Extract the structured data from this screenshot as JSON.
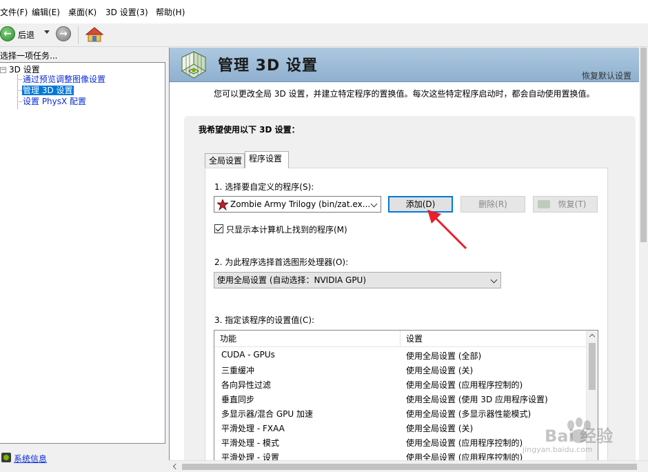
{
  "menu": {
    "items": [
      "文件(F)",
      "编辑(E)",
      "桌面(K)",
      "3D 设置(3)",
      "帮助(H)"
    ]
  },
  "toolbar": {
    "back_label": "后退"
  },
  "left_panel": {
    "header": "选择一项任务...",
    "tree": {
      "root": "3D 设置",
      "children": [
        "通过预览调整图像设置",
        "管理 3D 设置",
        "设置 PhysX 配置"
      ]
    },
    "system_info": "系统信息"
  },
  "banner": {
    "title": "管理 3D 设置",
    "restore_defaults": "恢复默认设置"
  },
  "description": "您可以更改全局 3D 设置，并建立特定程序的置换值。每次这些特定程序启动时，都会自动使用置换值。",
  "settings": {
    "heading": "我希望使用以下 3D 设置：",
    "tabs": [
      "全局设置",
      "程序设置"
    ],
    "step1": {
      "label": "1. 选择要自定义的程序(S):",
      "program_value": "Zombie Army Trilogy (bin/zat.ex...",
      "add_button": "添加(D)",
      "remove_button": "删除(R)",
      "restore_button": "恢复(T)",
      "checkbox_label": "只显示本计算机上找到的程序(M)",
      "checkbox_checked": true
    },
    "step2": {
      "label": "2. 为此程序选择首选图形处理器(O):",
      "gpu_value": "使用全局设置 (自动选择：NVIDIA GPU)"
    },
    "step3": {
      "label": "3. 指定该程序的设置值(C):",
      "columns": [
        "功能",
        "设置"
      ],
      "rows": [
        [
          "CUDA - GPUs",
          "使用全局设置 (全部)"
        ],
        [
          "三重缓冲",
          "使用全局设置 (关)"
        ],
        [
          "各向异性过滤",
          "使用全局设置 (应用程序控制的)"
        ],
        [
          "垂直同步",
          "使用全局设置 (使用 3D 应用程序设置)"
        ],
        [
          "多显示器/混合 GPU 加速",
          "使用全局设置 (多显示器性能模式)"
        ],
        [
          "平滑处理 - FXAA",
          "使用全局设置 (关)"
        ],
        [
          "平滑处理 - 模式",
          "使用全局设置 (应用程序控制的)"
        ],
        [
          "平滑处理 - 设置",
          "使用全局设置 (应用程序控制的)"
        ]
      ]
    }
  },
  "watermark": {
    "text": "Bai 经验",
    "sub": "jingyan.baidu.com"
  },
  "colors": {
    "selection": "#0078d7",
    "link": "#0a2ad8",
    "banner": "#9dbdd9",
    "annotation_arrow": "#e8202a"
  }
}
